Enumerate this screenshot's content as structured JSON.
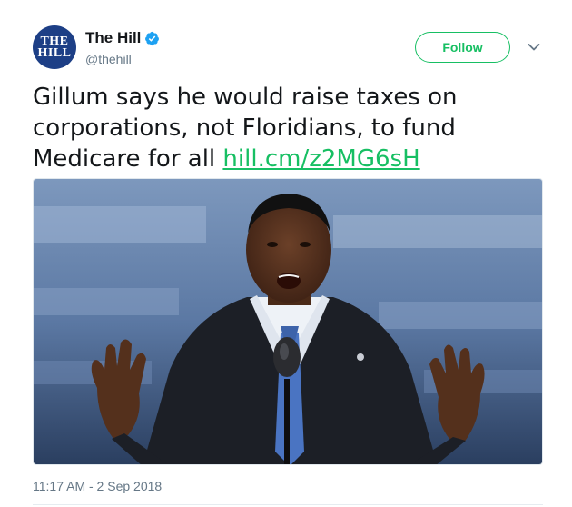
{
  "account": {
    "display_name": "The Hill",
    "handle": "@thehill",
    "avatar_line1": "THE",
    "avatar_line2": "HILL",
    "verified": true
  },
  "follow_label": "Follow",
  "tweet": {
    "text": "Gillum says he would raise taxes on corporations, not Floridians, to fund Medicare for all ",
    "link_text": "hill.cm/z2MG6sH"
  },
  "timestamp": "11:17 AM - 2 Sep 2018",
  "colors": {
    "accent_green": "#17bf63",
    "verified_blue": "#1da1f2",
    "avatar_navy": "#1d3f86",
    "muted_text": "#657786"
  },
  "icons": {
    "verified": "verified-badge-icon",
    "more": "chevron-down-icon"
  }
}
